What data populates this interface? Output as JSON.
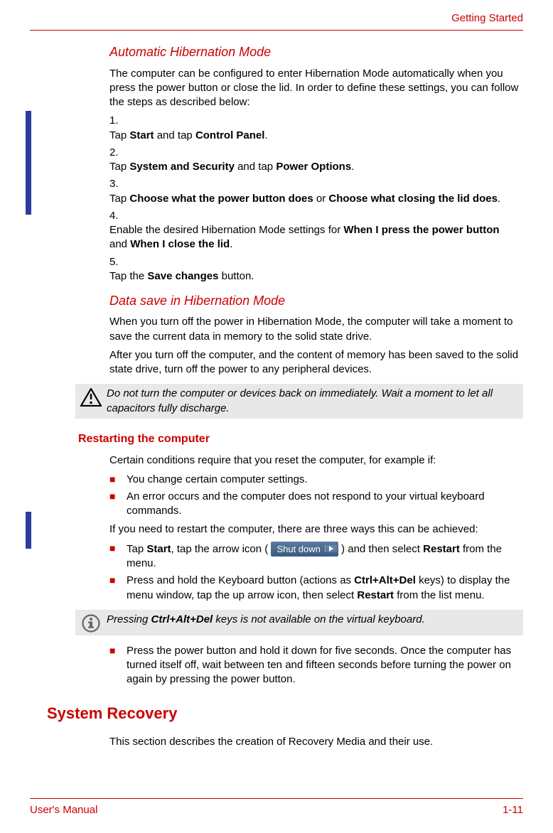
{
  "header": {
    "section": "Getting Started"
  },
  "footer": {
    "left": "User's Manual",
    "right": "1-11"
  },
  "s1": {
    "title": "Automatic Hibernation Mode",
    "intro": "The computer can be configured to enter Hibernation Mode automatically when you press the power button or close the lid. In order to define these settings, you can follow the steps as described below:",
    "steps": {
      "n1": "1.",
      "t1a": "Tap ",
      "t1b": "Start",
      "t1c": " and tap ",
      "t1d": "Control Panel",
      "t1e": ".",
      "n2": "2.",
      "t2a": "Tap ",
      "t2b": "System and Security",
      "t2c": " and tap ",
      "t2d": "Power Options",
      "t2e": ".",
      "n3": "3.",
      "t3a": "Tap ",
      "t3b": "Choose what the power button does",
      "t3c": " or ",
      "t3d": "Choose what closing the lid does",
      "t3e": ".",
      "n4": "4.",
      "t4a": "Enable the desired Hibernation Mode settings for ",
      "t4b": "When I press the power button",
      "t4c": " and ",
      "t4d": "When I close the lid",
      "t4e": ".",
      "n5": "5.",
      "t5a": "Tap the ",
      "t5b": "Save changes",
      "t5c": " button."
    }
  },
  "s2": {
    "title": "Data save in Hibernation Mode",
    "p1": "When you turn off the power in Hibernation Mode, the computer will take a moment to save the current data in memory to the solid state drive.",
    "p2": "After you turn off the computer, and the content of memory has been saved to the solid state drive, turn off the power to any peripheral devices.",
    "warn": "Do not turn the computer or devices back on immediately. Wait a moment to let all capacitors fully discharge."
  },
  "s3": {
    "title": "Restarting the computer",
    "p1": "Certain conditions require that you reset the computer, for example if:",
    "b1": "You change certain computer settings.",
    "b2": "An error occurs and the computer does not respond to your virtual keyboard commands.",
    "p2": "If you need to restart the computer, there are three ways this can be achieved:",
    "b3a": "Tap ",
    "b3b": "Start",
    "b3c": ", tap the arrow icon ( ",
    "b3d": " ) and then select ",
    "b3e": "Restart",
    "b3f": " from the menu.",
    "shutdown_label": "Shut down",
    "b4a": "Press and hold the Keyboard button (actions as ",
    "b4b": "Ctrl+Alt+Del",
    "b4c": " keys) to display the menu window, tap the up arrow icon, then select ",
    "b4d": "Restart",
    "b4e": " from the list menu.",
    "info_a": "Pressing ",
    "info_b": "Ctrl+Alt+Del",
    "info_c": " keys is not available on the virtual keyboard.",
    "b5": "Press the power button and hold it down for five seconds. Once the computer has turned itself off, wait between ten and fifteen seconds before turning the power on again by pressing the power button."
  },
  "s4": {
    "title": "System Recovery",
    "p1": "This section describes the creation of Recovery Media and their use."
  }
}
